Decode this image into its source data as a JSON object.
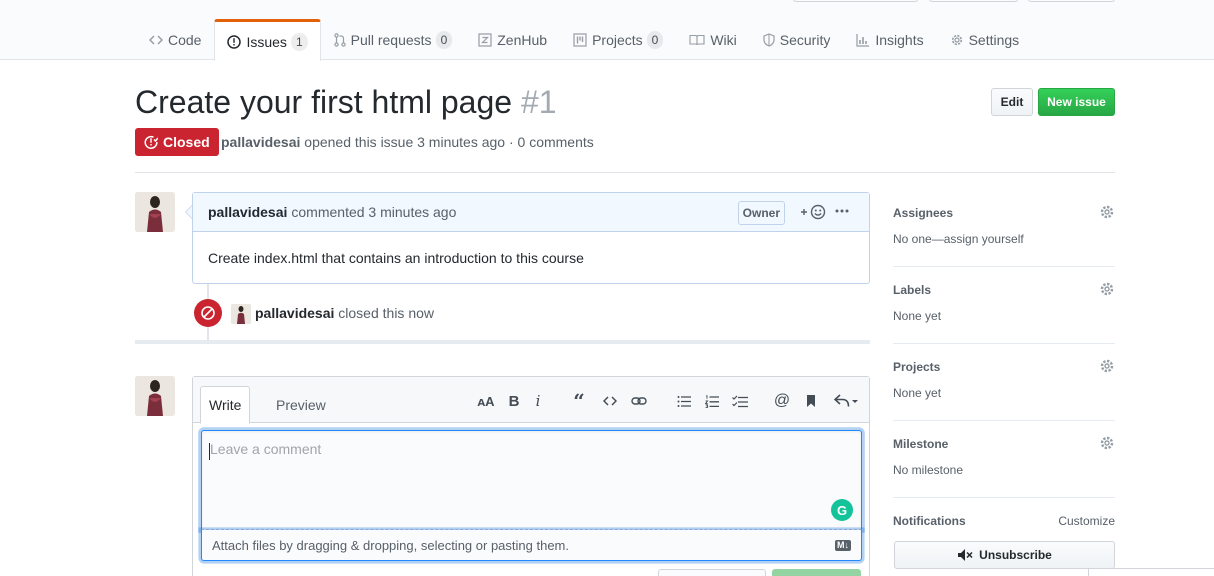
{
  "tabs": [
    {
      "label": "Code",
      "icon": "code-icon",
      "count": null
    },
    {
      "label": "Issues",
      "icon": "issue-icon",
      "count": "1",
      "selected": true
    },
    {
      "label": "Pull requests",
      "icon": "pull-request-icon",
      "count": "0"
    },
    {
      "label": "ZenHub",
      "icon": "zenhub-icon",
      "count": null
    },
    {
      "label": "Projects",
      "icon": "project-icon",
      "count": "0"
    },
    {
      "label": "Wiki",
      "icon": "book-icon",
      "count": null
    },
    {
      "label": "Security",
      "icon": "shield-icon",
      "count": null
    },
    {
      "label": "Insights",
      "icon": "graph-icon",
      "count": null
    },
    {
      "label": "Settings",
      "icon": "gear-icon",
      "count": null
    }
  ],
  "issue": {
    "title": "Create your first html page",
    "number": "#1",
    "state": "Closed",
    "author": "pallavidesai",
    "meta_rest": "opened this issue 3 minutes ago · 0 comments",
    "edit_label": "Edit",
    "new_issue_label": "New issue"
  },
  "comment": {
    "author": "pallavidesai",
    "action": "commented 3 minutes ago",
    "badge": "Owner",
    "body": "Create index.html that contains an introduction to this course"
  },
  "event": {
    "author": "pallavidesai",
    "text": "closed this now"
  },
  "composer": {
    "write_tab": "Write",
    "preview_tab": "Preview",
    "placeholder": "Leave a comment",
    "attach_text": "Attach files by dragging & dropping, selecting or pasting them.",
    "md_badge": "M↓"
  },
  "sidebar": {
    "assignees": {
      "title": "Assignees",
      "value": "No one—assign yourself"
    },
    "labels": {
      "title": "Labels",
      "value": "None yet"
    },
    "projects": {
      "title": "Projects",
      "value": "None yet"
    },
    "milestone": {
      "title": "Milestone",
      "value": "No milestone"
    },
    "notifications": {
      "title": "Notifications",
      "customize": "Customize",
      "unsubscribe": "Unsubscribe"
    }
  },
  "colors": {
    "accent_orange": "#e36209",
    "closed_red": "#cb2431",
    "new_issue_green": "#28a745",
    "comment_border": "#c0d3eb",
    "comment_header_bg": "#f1f8ff"
  }
}
